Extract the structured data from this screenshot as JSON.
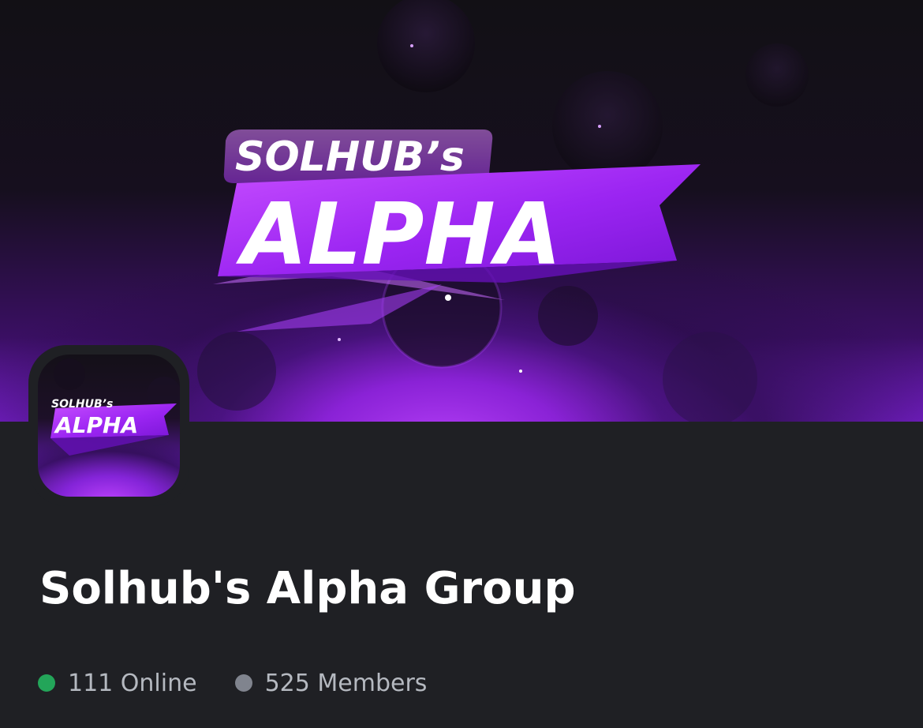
{
  "banner": {
    "logo_line1": "SOLHUB’s",
    "logo_line2": "ALPHA"
  },
  "avatar": {
    "logo_line1": "SOLHUB’s",
    "logo_line2": "ALPHA"
  },
  "server": {
    "name": "Solhub's Alpha Group",
    "online_label": "111 Online",
    "members_label": "525 Members"
  },
  "colors": {
    "background": "#1f2024",
    "accent_purple": "#9b30ff",
    "online_dot": "#23a559",
    "members_dot": "#80848e"
  },
  "icons": {
    "online": "online-status-dot-icon",
    "members": "members-status-dot-icon"
  }
}
